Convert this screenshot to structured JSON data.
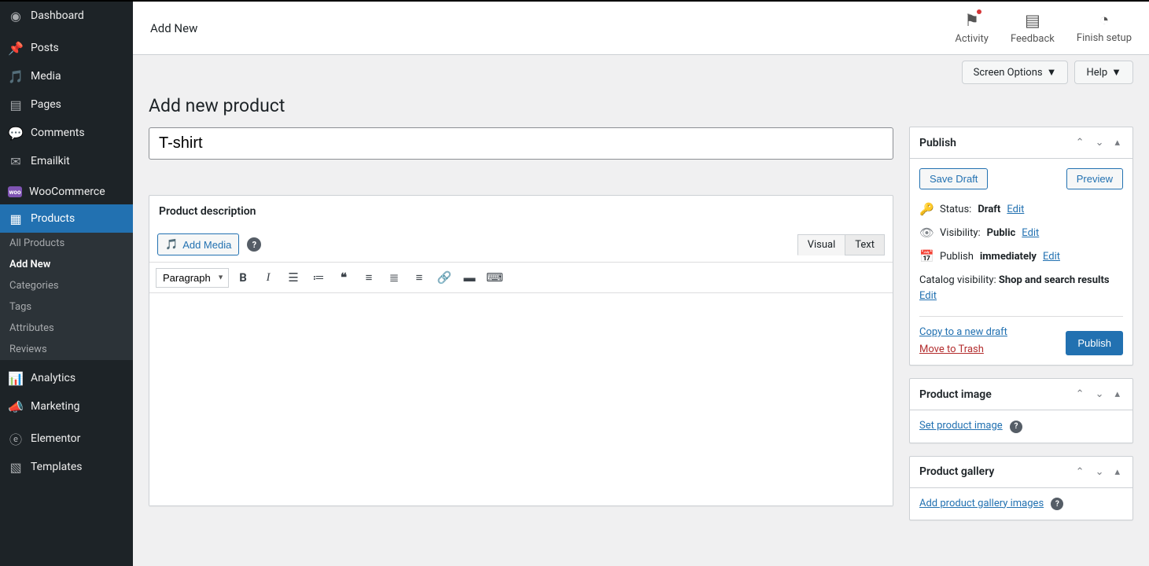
{
  "topbar": {
    "tab": "Add New",
    "activity": "Activity",
    "feedback": "Feedback",
    "finish": "Finish setup"
  },
  "options": {
    "screen": "Screen Options",
    "help": "Help"
  },
  "page": {
    "title": "Add new product",
    "product_title": "T-shirt"
  },
  "sidebar": {
    "dashboard": "Dashboard",
    "posts": "Posts",
    "media": "Media",
    "pages": "Pages",
    "comments": "Comments",
    "emailkit": "Emailkit",
    "woocommerce": "WooCommerce",
    "products": "Products",
    "analytics": "Analytics",
    "marketing": "Marketing",
    "elementor": "Elementor",
    "templates": "Templates",
    "sub": {
      "all": "All Products",
      "add": "Add New",
      "categories": "Categories",
      "tags": "Tags",
      "attributes": "Attributes",
      "reviews": "Reviews"
    }
  },
  "editor": {
    "panel_title": "Product description",
    "add_media": "Add Media",
    "visual": "Visual",
    "text": "Text",
    "paragraph": "Paragraph"
  },
  "publish": {
    "title": "Publish",
    "save_draft": "Save Draft",
    "preview": "Preview",
    "status_label": "Status:",
    "status_value": "Draft",
    "visibility_label": "Visibility:",
    "visibility_value": "Public",
    "publish_label": "Publish",
    "publish_value": "immediately",
    "catalog_label": "Catalog visibility:",
    "catalog_value": "Shop and search results",
    "edit": "Edit",
    "copy": "Copy to a new draft",
    "trash": "Move to Trash",
    "button": "Publish"
  },
  "product_image": {
    "title": "Product image",
    "link": "Set product image"
  },
  "gallery": {
    "title": "Product gallery",
    "link": "Add product gallery images"
  }
}
